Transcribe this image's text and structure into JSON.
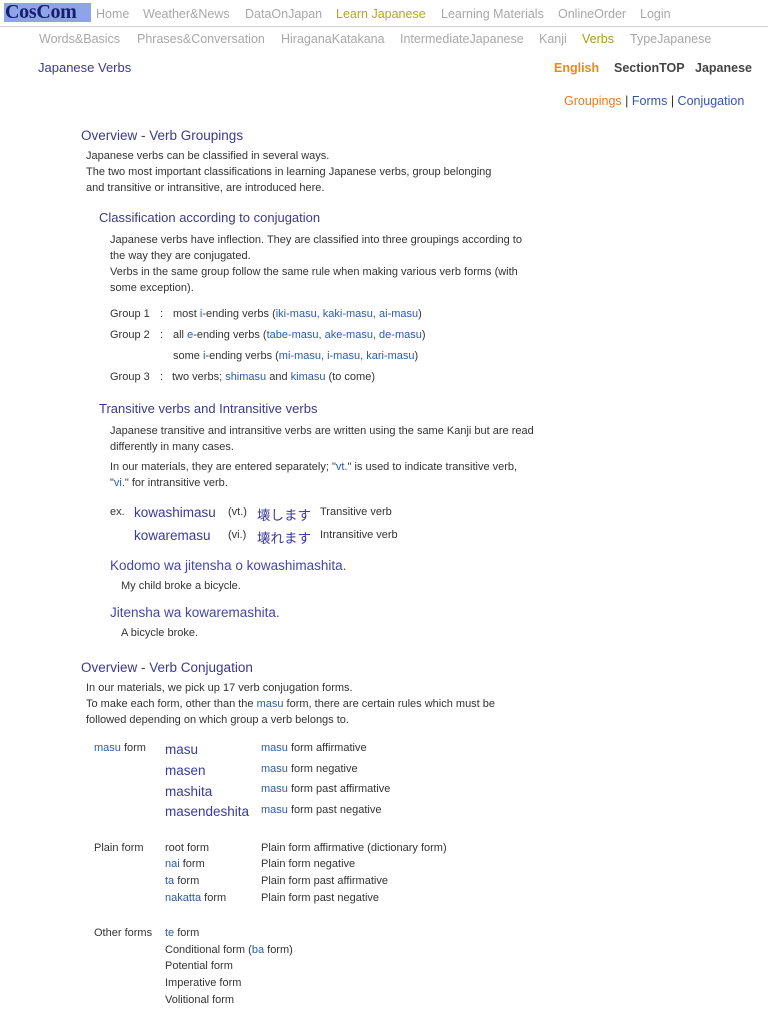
{
  "logo": "CosCom",
  "top_nav": [
    {
      "label": "Home",
      "active": false
    },
    {
      "label": "Weather&News",
      "active": false
    },
    {
      "label": "DataOnJapan",
      "active": false
    },
    {
      "label": "Learn Japanese",
      "active": true
    },
    {
      "label": "Learning Materials",
      "active": false
    },
    {
      "label": "OnlineOrder",
      "active": false
    },
    {
      "label": "Login",
      "active": false
    }
  ],
  "sub_nav": [
    {
      "label": "Words&Basics",
      "active": false
    },
    {
      "label": "Phrases&Conversation",
      "active": false
    },
    {
      "label": "HiraganaKatakana",
      "active": false
    },
    {
      "label": "IntermediateJapanese",
      "active": false
    },
    {
      "label": "Kanji",
      "active": false
    },
    {
      "label": "Verbs",
      "active": true
    },
    {
      "label": "TypeJapanese",
      "active": false
    }
  ],
  "page_title": "Japanese Verbs",
  "lang": {
    "english": "English",
    "section_top": "SectionTOP",
    "japanese": "Japanese"
  },
  "anchors": {
    "groupings": "Groupings",
    "sep": "|",
    "forms": "Forms",
    "conjugation": "Conjugation"
  },
  "groupings": {
    "heading": "Overview - Verb Groupings",
    "intro": [
      "Japanese verbs can be classified in several ways.",
      "The two most important classifications in learning Japanese verbs, group belonging",
      "and transitive or intransitive, are introduced here."
    ],
    "classification": {
      "heading": "Classification according to conjugation",
      "text": [
        "Japanese verbs have inflection. They are classified into three groupings according to",
        "the way they are conjugated.",
        "Verbs in the same group follow the same rule when making various verb forms (with",
        "some exception)."
      ],
      "groups": [
        {
          "label": "Group 1",
          "colon": ":",
          "pre": "most ",
          "hl": "i",
          "mid": "-ending verbs (",
          "ex": "iki-masu, kaki-masu, ai-masu",
          "post": ")"
        },
        {
          "label": "Group 2",
          "colon": ":",
          "pre": "all ",
          "hl": "e",
          "mid": "-ending verbs (",
          "ex": "tabe-masu, ake-masu, de-masu",
          "post": ")"
        },
        {
          "label": "",
          "colon": "",
          "pre": "some ",
          "hl": "i",
          "mid": "-ending verbs (",
          "ex": "mi-masu, i-masu, kari-masu",
          "post": ")"
        },
        {
          "label": "Group 3",
          "colon": ":",
          "pre": "two verbs; ",
          "hl": "shimasu",
          "mid": " and ",
          "ex": "kimasu",
          "post": " (to come)"
        }
      ]
    },
    "transitive": {
      "heading": "Transitive verbs and Intransitive verbs",
      "text1": [
        "Japanese transitive and intransitive verbs are written using the same Kanji but are read",
        "differently in many cases."
      ],
      "text2_a": "In our materials, they are entered separately; \"",
      "text2_vt": "vt.",
      "text2_b": "\" is used to indicate transitive verb,",
      "text3_a": "\"",
      "text3_vi": "vi.",
      "text3_b": "\" for intransitive verb.",
      "ex_label": "ex.",
      "examples": [
        {
          "romaji": "kowashimasu",
          "tag": "(vt.)",
          "kana": "壊します",
          "meaning": "Transitive verb"
        },
        {
          "romaji": "kowaremasu",
          "tag": "(vi.)",
          "kana": "壊れます",
          "meaning": "Intransitive verb"
        }
      ],
      "sentences": [
        {
          "jp": "Kodomo wa jitensha o kowashimashita.",
          "en": "My child broke a bicycle."
        },
        {
          "jp": "Jitensha wa kowaremashita.",
          "en": "A bicycle broke."
        }
      ]
    }
  },
  "conjugation": {
    "heading": "Overview - Verb Conjugation",
    "intro1": "In our materials, we pick up 17 verb conjugation forms.",
    "intro2_a": "To make each form, other than the ",
    "intro2_hl": "masu",
    "intro2_b": " form, there are certain rules which must be",
    "intro3": "followed depending on which group a verb belongs to.",
    "masu": {
      "label_hl": "masu",
      "label_rest": " form",
      "rows": [
        {
          "form": "masu",
          "desc_hl": "masu",
          "desc": " form affirmative"
        },
        {
          "form": "masen",
          "desc_hl": "masu",
          "desc": " form negative"
        },
        {
          "form": "mashita",
          "desc_hl": "masu",
          "desc": " form past affirmative"
        },
        {
          "form": "masendeshita",
          "desc_hl": "masu",
          "desc": " form past negative"
        }
      ]
    },
    "plain": {
      "label": "Plain form",
      "rows": [
        {
          "hl": "",
          "form": "root form",
          "desc": "Plain form affirmative (dictionary form)"
        },
        {
          "hl": "nai",
          "form": " form",
          "desc": "Plain form negative"
        },
        {
          "hl": "ta",
          "form": " form",
          "desc": "Plain form past affirmative"
        },
        {
          "hl": "nakatta",
          "form": " form",
          "desc": "Plain form past negative"
        }
      ]
    },
    "other": {
      "label": "Other forms",
      "te_hl": "te",
      "te_rest": " form",
      "cond_a": "Conditional form (",
      "cond_hl": "ba",
      "cond_b": " form)",
      "potential": "Potential form",
      "imperative": "Imperative form",
      "volitional": "Volitional form"
    }
  }
}
